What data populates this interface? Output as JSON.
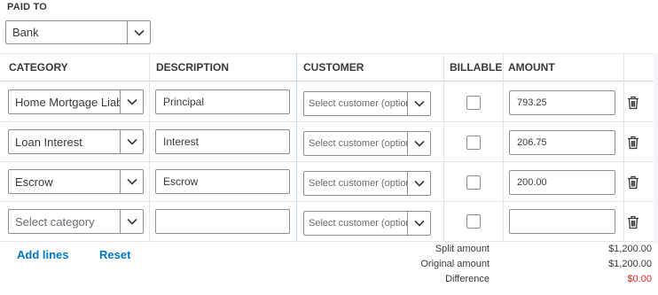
{
  "paid_to": {
    "label": "PAID TO",
    "selected": "Bank"
  },
  "table": {
    "headers": {
      "category": "CATEGORY",
      "description": "DESCRIPTION",
      "customer": "CUSTOMER",
      "billable": "BILLABLE",
      "amount": "AMOUNT"
    },
    "rows": [
      {
        "category": "Home Mortgage Liability",
        "description": "Principal",
        "customer_placeholder": "Select customer (optional)",
        "billable": false,
        "amount": "793.25"
      },
      {
        "category": "Loan Interest",
        "description": "Interest",
        "customer_placeholder": "Select customer (optional)",
        "billable": false,
        "amount": "206.75"
      },
      {
        "category": "Escrow",
        "description": "Escrow",
        "customer_placeholder": "Select customer (optional)",
        "billable": false,
        "amount": "200.00"
      },
      {
        "category": "",
        "category_placeholder": "Select category",
        "description": "",
        "customer_placeholder": "Select customer (optional)",
        "billable": false,
        "amount": ""
      }
    ]
  },
  "actions": {
    "add_lines": "Add lines",
    "reset": "Reset"
  },
  "summary": {
    "split_amount_label": "Split amount",
    "split_amount_value": "$1,200.00",
    "original_amount_label": "Original amount",
    "original_amount_value": "$1,200.00",
    "difference_label": "Difference",
    "difference_value": "$0.00"
  },
  "colors": {
    "link": "#0077c5",
    "difference": "#d52b1e",
    "border": "#8d9096"
  },
  "icons": {
    "chevron": "chevron-down-icon",
    "trash": "trash-icon"
  }
}
